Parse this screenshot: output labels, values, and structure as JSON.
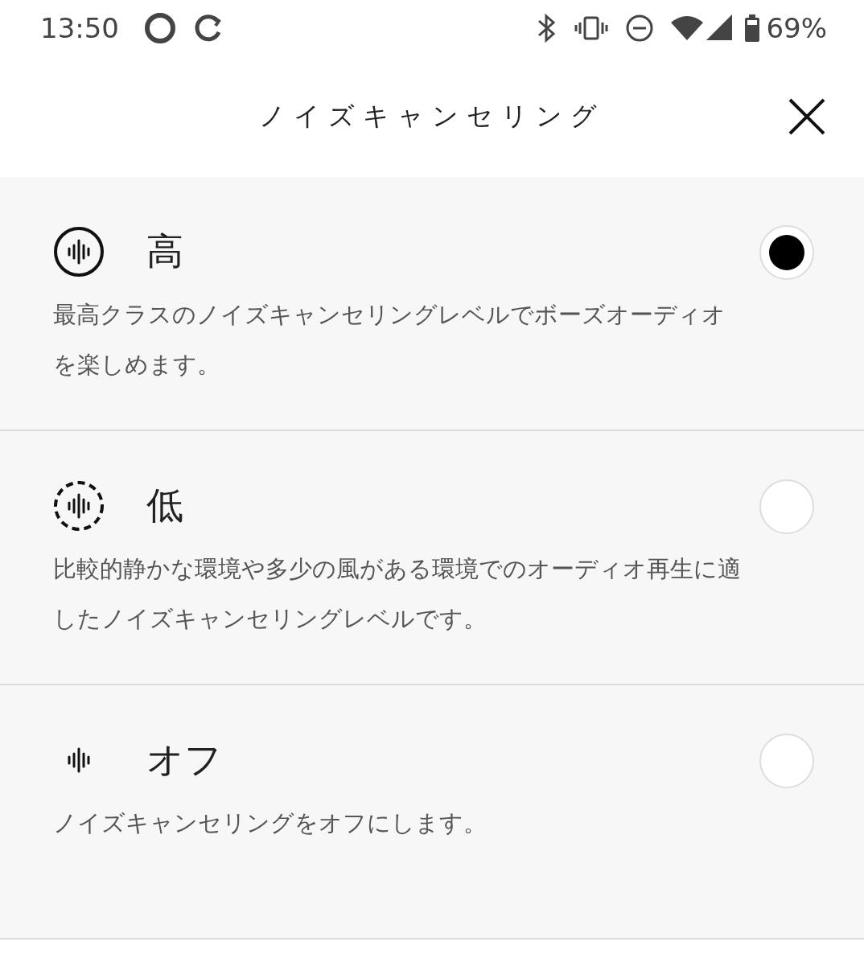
{
  "status_bar": {
    "time": "13:50",
    "battery": "69%"
  },
  "header": {
    "title": "ノイズキャンセリング"
  },
  "options": [
    {
      "kind": "ring",
      "label": "高",
      "description": "最高クラスのノイズキャンセリングレベルでボーズオーディオを楽しめます。",
      "selected": true
    },
    {
      "kind": "dashed",
      "label": "低",
      "description": "比較的静かな環境や多少の風がある環境でのオーディオ再生に適したノイズキャンセリングレベルです。",
      "selected": false
    },
    {
      "kind": "plain",
      "label": "オフ",
      "description": "ノイズキャンセリングをオフにします。",
      "selected": false
    }
  ]
}
